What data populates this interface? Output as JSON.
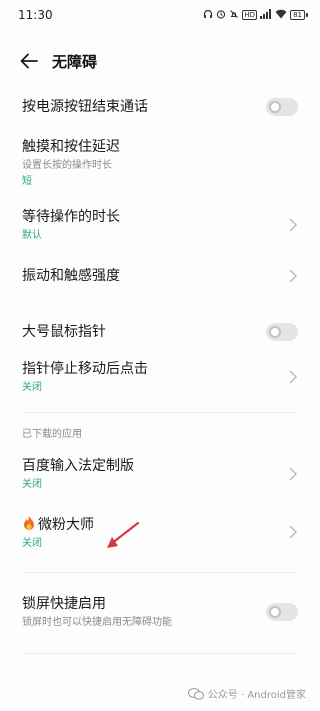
{
  "status_bar": {
    "time": "11:30",
    "icons": [
      "headphones-icon",
      "alarm-icon",
      "bell-off-icon",
      "hd-icon",
      "signal-icon",
      "wifi-icon"
    ],
    "hd_label": "HD",
    "battery": "81"
  },
  "header": {
    "back_icon": "arrow-left-icon",
    "title": "无障碍"
  },
  "items": {
    "power_end_call": {
      "label": "按电源按钮结束通话",
      "toggle": false
    },
    "touch_hold_delay": {
      "label": "触摸和按住延迟",
      "sub": "设置长按的操作时长",
      "value": "短"
    },
    "wait_duration": {
      "label": "等待操作的时长",
      "value": "默认"
    },
    "vibration": {
      "label": "振动和触感强度"
    },
    "large_pointer": {
      "label": "大号鼠标指针",
      "toggle": false
    },
    "dwell_click": {
      "label": "指针停止移动后点击",
      "value": "关闭"
    }
  },
  "downloaded": {
    "section_title": "已下载的应用",
    "baidu": {
      "label": "百度输入法定制版",
      "value": "关闭"
    },
    "weifen": {
      "label": "微粉大师",
      "value": "关闭",
      "icon": "fire-icon"
    }
  },
  "lockscreen": {
    "label": "锁屏快捷启用",
    "sub": "锁屏时也可以快捷启用无障碍功能",
    "toggle": false
  },
  "watermark": {
    "text": "公众号 · Android管家"
  },
  "colors": {
    "accent_green": "#2aa78e",
    "annotation_red": "#d9363e",
    "toggle_off": "#e5e5e5"
  }
}
